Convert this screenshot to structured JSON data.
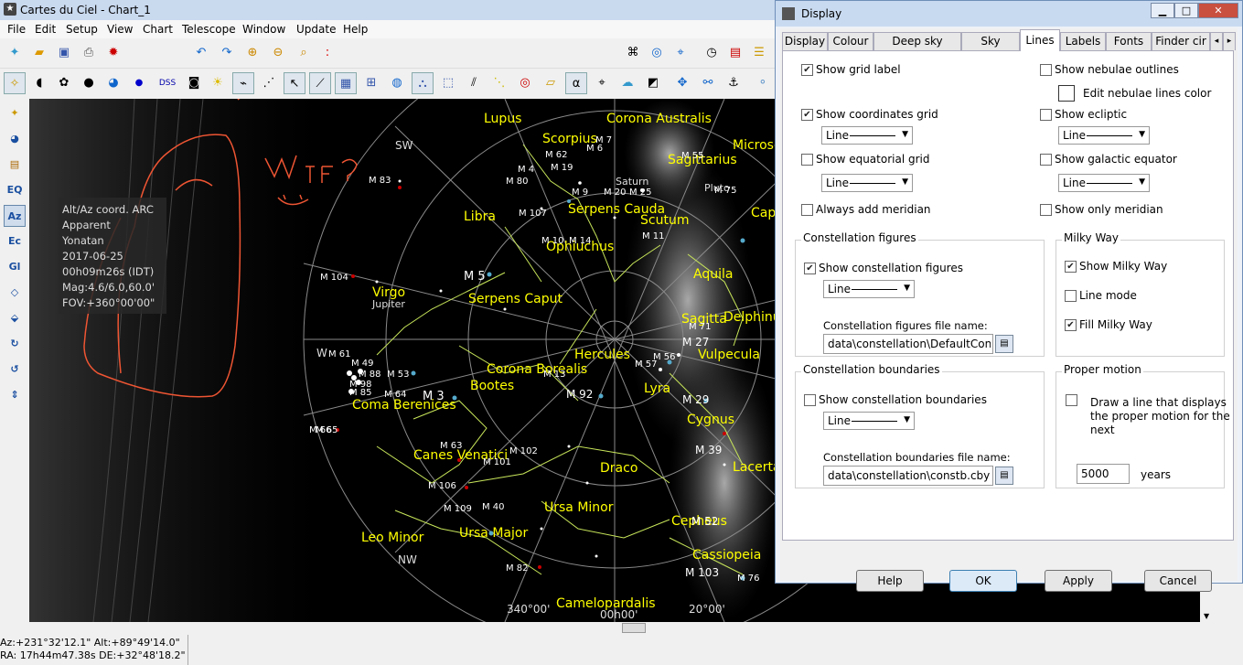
{
  "window": {
    "title": "Cartes du Ciel - Chart_1"
  },
  "menu": [
    "File",
    "Edit",
    "Setup",
    "View",
    "Chart",
    "Telescope",
    "Window",
    "Update",
    "Help"
  ],
  "toolbar2": {
    "dss_label": "DSS",
    "alpha": "α"
  },
  "left_toolbar": {
    "eq": "EQ",
    "az": "Az",
    "ec": "Ec",
    "gl": "Gl"
  },
  "chart_info": {
    "line1": "Alt/Az coord. ARC",
    "line2": "Apparent",
    "line3": "Yonatan",
    "line4": "2017-06-25",
    "line5": "00h09m26s (IDT)",
    "line6": "Mag:4.6/6.0,60.0'",
    "line7": "FOV:+360°00'00\""
  },
  "annotation": {
    "text": "WTF ?"
  },
  "sky": {
    "constellations": [
      "Lupus",
      "Corona Australis",
      "Scorpius",
      "Sagittarius",
      "Microscopium",
      "Libra",
      "Serpens Cauda",
      "Scutum",
      "Capricornus",
      "Ophiuchus",
      "Aquila",
      "Virgo",
      "Serpens Caput",
      "Sagitta",
      "Delphinus",
      "Hercules",
      "Vulpecula",
      "Corona Borealis",
      "Bootes",
      "Lyra",
      "Coma Berenices",
      "Cygnus",
      "Canes Venatici",
      "Draco",
      "Lacerta",
      "Ursa Minor",
      "Ursa Major",
      "Cepheus",
      "Leo Minor",
      "Cassiopeia",
      "Camelopardalis"
    ],
    "objects": [
      "M 83",
      "M 4",
      "M 80",
      "M 62",
      "M 19",
      "M 6",
      "M 7",
      "M 9",
      "M 20",
      "M 25",
      "M 107",
      "M 10",
      "M 14",
      "M 11",
      "M 104",
      "M 5",
      "M 13",
      "M 53",
      "M 3",
      "M 64",
      "M 92",
      "M 57",
      "M 56",
      "M 27",
      "M 29",
      "M 39",
      "M 63",
      "M 102",
      "M 101",
      "M 106",
      "M 109",
      "M 40",
      "M 82",
      "M 52",
      "M 103",
      "M 76",
      "M 61",
      "M 49",
      "M 85",
      "M 98",
      "M 88",
      "M 66",
      "M 65",
      "M 55",
      "M 75",
      "M 71"
    ],
    "planets": [
      "Jupiter",
      "Pluto",
      "Saturn"
    ],
    "cardinal": [
      "SW",
      "W",
      "NW"
    ],
    "scale": [
      "340°00'",
      "00h00'",
      "20°00'"
    ]
  },
  "status": {
    "line1": "Az:+231°32'12.1\" Alt:+89°49'14.0\"",
    "line2": "RA: 17h44m47.38s DE:+32°48'18.2\""
  },
  "dialog": {
    "title": "Display",
    "tabs": [
      "Display",
      "Colour",
      "Deep sky colour",
      "Sky colour",
      "Lines",
      "Labels",
      "Fonts",
      "Finder cir"
    ],
    "active_tab": "Lines",
    "show_grid_label": "Show grid label",
    "show_nebulae_outlines": "Show nebulae outlines",
    "edit_nebulae_lines_color": "Edit nebulae lines color",
    "show_coordinates_grid": "Show coordinates grid",
    "show_ecliptic": "Show ecliptic",
    "show_equatorial_grid": "Show equatorial grid",
    "show_galactic_equator": "Show galactic equator",
    "always_add_meridian": "Always add meridian",
    "show_only_meridian": "Show only meridian",
    "line_option": "Line",
    "constellation_figures_group": "Constellation figures",
    "show_constellation_figures": "Show constellation figures",
    "constellation_figures_file_label": "Constellation figures file name:",
    "constellation_figures_file": "data\\constellation\\DefaultConstL",
    "milky_way_group": "Milky Way",
    "show_milky_way": "Show Milky Way",
    "line_mode": "Line mode",
    "fill_milky_way": "Fill Milky Way",
    "constellation_boundaries_group": "Constellation boundaries",
    "show_constellation_boundaries": "Show constellation boundaries",
    "constellation_boundaries_file_label": "Constellation boundaries file name:",
    "constellation_boundaries_file": "data\\constellation\\constb.cby",
    "proper_motion_group": "Proper motion",
    "proper_motion_text1": "Draw a line that displays",
    "proper_motion_text2": "the proper motion for the",
    "proper_motion_text3": "next",
    "years_value": "5000",
    "years_label": "years",
    "help": "Help",
    "ok": "OK",
    "apply": "Apply",
    "cancel": "Cancel",
    "checked": {
      "show_grid_label": true,
      "show_nebulae_outlines": false,
      "edit_nebulae_lines_color": false,
      "show_coordinates_grid": true,
      "show_ecliptic": false,
      "show_equatorial_grid": false,
      "show_galactic_equator": false,
      "always_add_meridian": false,
      "show_only_meridian": false,
      "show_constellation_figures": true,
      "show_milky_way": true,
      "line_mode": false,
      "fill_milky_way": true,
      "show_constellation_boundaries": false,
      "proper_motion": false
    }
  }
}
